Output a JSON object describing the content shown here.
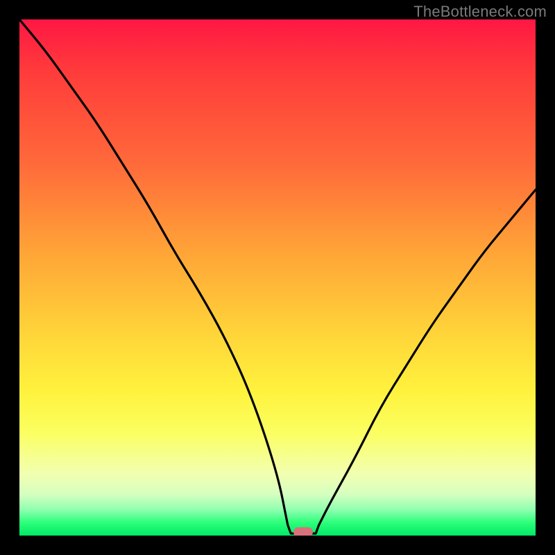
{
  "watermark": "TheBottleneck.com",
  "chart_data": {
    "type": "line",
    "title": "",
    "xlabel": "",
    "ylabel": "",
    "xlim": [
      0,
      100
    ],
    "ylim": [
      0,
      100
    ],
    "grid": false,
    "series": [
      {
        "name": "bottleneck-curve",
        "x": [
          0,
          5,
          10,
          15,
          20,
          25,
          30,
          35,
          40,
          45,
          50,
          52,
          55,
          58,
          60,
          65,
          70,
          75,
          80,
          85,
          90,
          95,
          100
        ],
        "values": [
          100,
          94,
          87,
          80,
          72,
          64,
          55,
          47,
          38,
          27,
          12,
          2,
          0,
          2,
          6,
          15,
          25,
          33,
          41,
          48,
          55,
          61,
          67
        ]
      }
    ],
    "marker": {
      "x": 55,
      "y": 0,
      "color": "#d9717a"
    },
    "background_gradient": {
      "top": "#ff1744",
      "bottom": "#00e865"
    }
  }
}
